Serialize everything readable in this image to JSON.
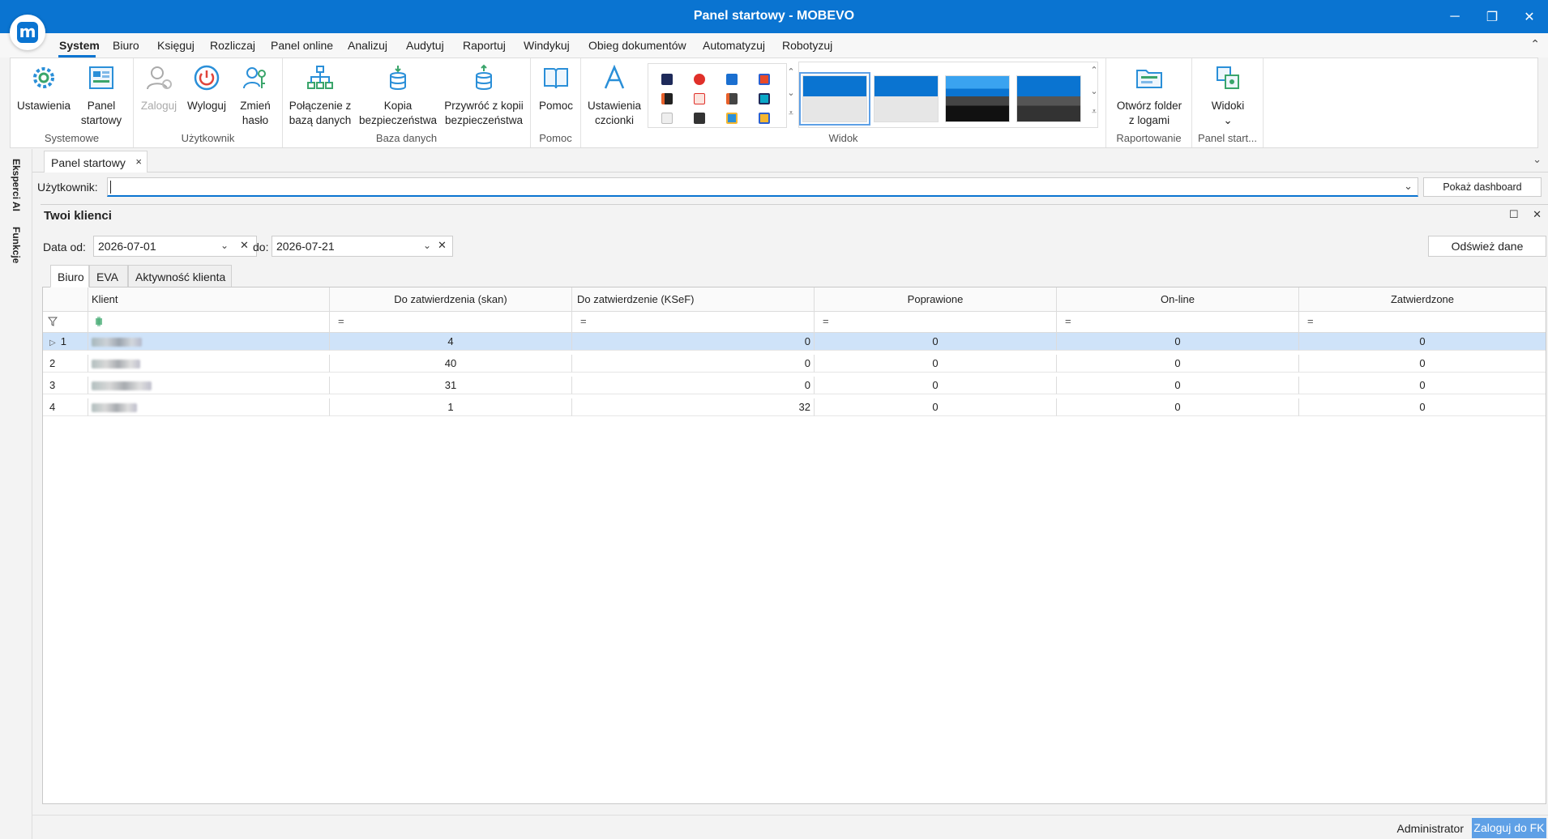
{
  "window": {
    "title": "Panel startowy - MOBEVO",
    "minimize": "─",
    "restore": "❐",
    "close": "✕"
  },
  "menu": {
    "items": [
      "System",
      "Biuro",
      "Księguj",
      "Rozliczaj",
      "Panel online",
      "Analizuj",
      "Audytuj",
      "Raportuj",
      "Windykuj",
      "Obieg dokumentów",
      "Automatyzuj",
      "Robotyzuj"
    ],
    "active": "System",
    "collapse": "⌃"
  },
  "ribbon": {
    "groups": {
      "systemowe": "Systemowe",
      "uzytkownik": "Użytkownik",
      "baza": "Baza danych",
      "pomoc": "Pomoc",
      "widok": "Widok",
      "raportowanie": "Raportowanie",
      "panel": "Panel start..."
    },
    "buttons": {
      "ustawienia": "Ustawienia",
      "panel_l1": "Panel",
      "panel_l2": "startowy",
      "zaloguj": "Zaloguj",
      "wyloguj": "Wyloguj",
      "zmien_l1": "Zmień",
      "zmien_l2": "hasło",
      "polaczenie_l1": "Połączenie z",
      "polaczenie_l2": "bazą danych",
      "kopia_l1": "Kopia",
      "kopia_l2": "bezpieczeństwa",
      "przywroc_l1": "Przywróć z kopii",
      "przywroc_l2": "bezpieczeństwa",
      "pomoc": "Pomoc",
      "czcionki_l1": "Ustawienia",
      "czcionki_l2": "czcionki",
      "folder_l1": "Otwórz folder",
      "folder_l2": "z logami",
      "widoki": "Widoki",
      "widoki_arrow": "⌄"
    },
    "accent": "#0a74d1"
  },
  "side": {
    "eksperci": "Eksperci AI",
    "funkcje": "Funkcje"
  },
  "doc_tab": {
    "label": "Panel startowy",
    "close": "×",
    "overflow": "⌄"
  },
  "user_row": {
    "label": "Użytkownik:",
    "value": "",
    "button": "Pokaż dashboard"
  },
  "panel": {
    "title": "Twoi klienci",
    "maximize": "☐",
    "close": "✕",
    "date_from_label": "Data od:",
    "date_from": "2026-07-01",
    "date_to_label": "do:",
    "date_to": "2026-07-21",
    "refresh": "Odśwież dane",
    "tabs": [
      "Biuro",
      "EVA",
      "Aktywność klienta"
    ],
    "active_tab": "Biuro"
  },
  "grid": {
    "columns": [
      "Klient",
      "Do zatwierdzenia (skan)",
      "Do zatwierdzenie (KSeF)",
      "Poprawione",
      "On-line",
      "Zatwierdzone"
    ],
    "filter_symbol": "=",
    "rows": [
      {
        "n": "1",
        "skan": "4",
        "ksef": "0",
        "poprawione": "0",
        "online": "0",
        "zatwierdzone": "0",
        "selected": true
      },
      {
        "n": "2",
        "skan": "40",
        "ksef": "0",
        "poprawione": "0",
        "online": "0",
        "zatwierdzone": "0",
        "selected": false
      },
      {
        "n": "3",
        "skan": "31",
        "ksef": "0",
        "poprawione": "0",
        "online": "0",
        "zatwierdzone": "0",
        "selected": false
      },
      {
        "n": "4",
        "skan": "1",
        "ksef": "32",
        "poprawione": "0",
        "online": "0",
        "zatwierdzone": "0",
        "selected": false
      }
    ]
  },
  "status": {
    "user": "Administrator",
    "login_button": "Zaloguj do FK"
  }
}
